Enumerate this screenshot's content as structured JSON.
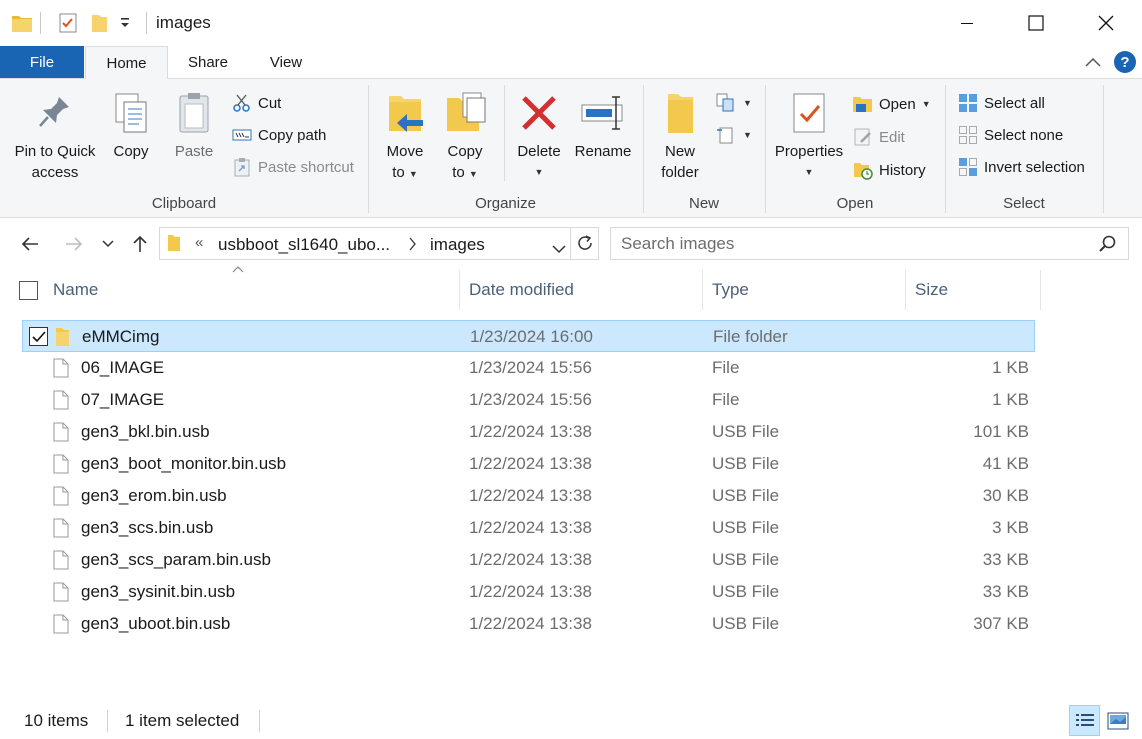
{
  "window": {
    "title": "images",
    "minimize": "minimize",
    "maximize": "maximize",
    "close": "close"
  },
  "tabs": {
    "file": "File",
    "home": "Home",
    "share": "Share",
    "view": "View",
    "active": "Home",
    "help": "?"
  },
  "ribbon": {
    "clipboard": {
      "label": "Clipboard",
      "pin_line1": "Pin to Quick",
      "pin_line2": "access",
      "copy": "Copy",
      "paste": "Paste",
      "cut": "Cut",
      "copy_path": "Copy path",
      "paste_shortcut": "Paste shortcut"
    },
    "organize": {
      "label": "Organize",
      "move_line1": "Move",
      "move_line2": "to",
      "copy_line1": "Copy",
      "copy_line2": "to",
      "delete": "Delete",
      "rename": "Rename"
    },
    "new": {
      "label": "New",
      "folder_line1": "New",
      "folder_line2": "folder"
    },
    "open": {
      "label": "Open",
      "properties": "Properties",
      "open": "Open",
      "edit": "Edit",
      "history": "History"
    },
    "select": {
      "label": "Select",
      "select_all": "Select all",
      "select_none": "Select none",
      "invert": "Invert selection"
    }
  },
  "address": {
    "overflow": "«",
    "parent": "usbboot_sl1640_ubo...",
    "current": "images"
  },
  "search": {
    "placeholder": "Search images"
  },
  "columns": {
    "name": "Name",
    "date": "Date modified",
    "type": "Type",
    "size": "Size"
  },
  "files": [
    {
      "name": "eMMCimg",
      "date": "1/23/2024 16:00",
      "type": "File folder",
      "size": "",
      "kind": "folder",
      "selected": true
    },
    {
      "name": "06_IMAGE",
      "date": "1/23/2024 15:56",
      "type": "File",
      "size": "1 KB",
      "kind": "file",
      "selected": false
    },
    {
      "name": "07_IMAGE",
      "date": "1/23/2024 15:56",
      "type": "File",
      "size": "1 KB",
      "kind": "file",
      "selected": false
    },
    {
      "name": "gen3_bkl.bin.usb",
      "date": "1/22/2024 13:38",
      "type": "USB File",
      "size": "101 KB",
      "kind": "file",
      "selected": false
    },
    {
      "name": "gen3_boot_monitor.bin.usb",
      "date": "1/22/2024 13:38",
      "type": "USB File",
      "size": "41 KB",
      "kind": "file",
      "selected": false
    },
    {
      "name": "gen3_erom.bin.usb",
      "date": "1/22/2024 13:38",
      "type": "USB File",
      "size": "30 KB",
      "kind": "file",
      "selected": false
    },
    {
      "name": "gen3_scs.bin.usb",
      "date": "1/22/2024 13:38",
      "type": "USB File",
      "size": "3 KB",
      "kind": "file",
      "selected": false
    },
    {
      "name": "gen3_scs_param.bin.usb",
      "date": "1/22/2024 13:38",
      "type": "USB File",
      "size": "33 KB",
      "kind": "file",
      "selected": false
    },
    {
      "name": "gen3_sysinit.bin.usb",
      "date": "1/22/2024 13:38",
      "type": "USB File",
      "size": "33 KB",
      "kind": "file",
      "selected": false
    },
    {
      "name": "gen3_uboot.bin.usb",
      "date": "1/22/2024 13:38",
      "type": "USB File",
      "size": "307 KB",
      "kind": "file",
      "selected": false
    }
  ],
  "status": {
    "items": "10 items",
    "selected": "1 item selected"
  },
  "colors": {
    "accent": "#1a64b4",
    "selection_bg": "#cce8ff",
    "selection_border": "#99d1ff",
    "folder": "#f2c94c",
    "delete_red": "#d32f2f"
  }
}
